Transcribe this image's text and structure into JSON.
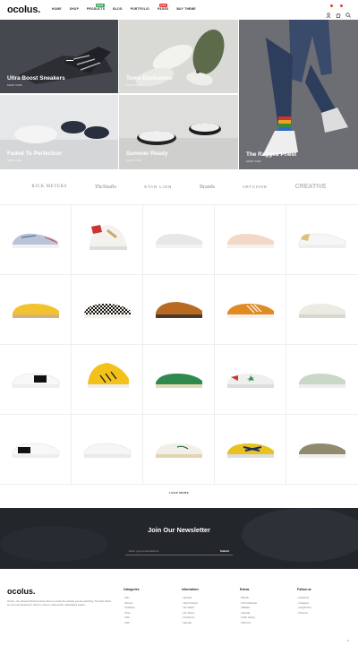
{
  "header": {
    "logo": "ocolus.",
    "nav": [
      {
        "label": "HOME",
        "badge": null
      },
      {
        "label": "SHOP",
        "badge": null
      },
      {
        "label": "PRODUCTS",
        "badge": "NEW",
        "badge_color": "#3aa35b"
      },
      {
        "label": "BLOG",
        "badge": null
      },
      {
        "label": "PORTFOLIO",
        "badge": null
      },
      {
        "label": "PAGES",
        "badge": "HOT",
        "badge_color": "#e53935"
      },
      {
        "label": "BUY THEME",
        "badge": null
      }
    ],
    "icons": [
      "user-icon",
      "cart-icon",
      "search-icon"
    ]
  },
  "hero": {
    "tiles": [
      {
        "title": "Ultra Boost Sneakers",
        "sub": "SHOP NOW"
      },
      {
        "title": "Toms Exclusives",
        "sub": "SHOP NOW"
      },
      {
        "title": "The Ragged Priest",
        "sub": "SHOP NOW"
      },
      {
        "title": "Faded To Perfection",
        "sub": "SHOP NOW"
      },
      {
        "title": "Summer Ready",
        "sub": "SHOP NOW"
      }
    ]
  },
  "brands": [
    {
      "name": "RICK METERS",
      "icon": "rick-meters-logo"
    },
    {
      "name": "TheStudio",
      "icon": "thestudio-logo"
    },
    {
      "name": "STAR LION",
      "icon": "star-lion-logo"
    },
    {
      "name": "Brands",
      "icon": "brands-logo"
    },
    {
      "name": "ARTCHIVE",
      "icon": "artchive-logo"
    },
    {
      "name": "CREATIVE",
      "icon": "creative-logo"
    }
  ],
  "load_more": "LOAD MORE",
  "newsletter": {
    "title": "Join Our Newsletter",
    "placeholder": "Enter your email address",
    "submit": "Submit"
  },
  "footer": {
    "logo": "ocolus.",
    "description": "Ocolus - the ultimate WooCommerce theme to create the website you are searching. The best choice for your next personal or client's e-shop or multi-vendor marketplace project.",
    "columns": [
      {
        "title": "Categories",
        "links": [
          "Men",
          "Women",
          "Sneakers",
          "Shop",
          "Sale",
          "Kids"
        ]
      },
      {
        "title": "Information",
        "links": [
          "Specials",
          "New Products",
          "Top Sellers",
          "Our Stores",
          "Contact Us",
          "Sitemap"
        ]
      },
      {
        "title": "Extras",
        "links": [
          "Brands",
          "Gift Certificates",
          "Affiliates",
          "Specials",
          "Order History",
          "Wish List"
        ]
      },
      {
        "title": "Follow us",
        "links": [
          "Facebook",
          "Instagram",
          "Google Plus",
          "Pinterest"
        ]
      }
    ]
  },
  "colors": {
    "accent": "#e53935",
    "new_badge": "#3aa35b",
    "newsletter_bg": "#23262b"
  }
}
